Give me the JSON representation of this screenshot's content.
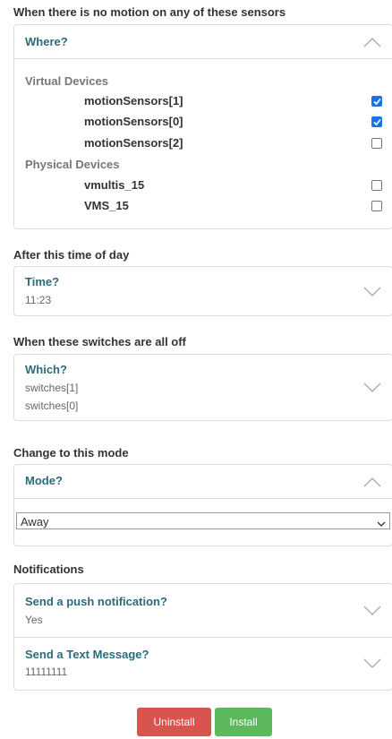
{
  "motion": {
    "section_title": "When there is no motion on any of these sensors",
    "header_label": "Where?",
    "group_virtual": "Virtual Devices",
    "group_physical": "Physical Devices",
    "virtual_devices": [
      {
        "name": "motionSensors[1]",
        "checked": true
      },
      {
        "name": "motionSensors[0]",
        "checked": true
      },
      {
        "name": "motionSensors[2]",
        "checked": false
      }
    ],
    "physical_devices": [
      {
        "name": "vmultis_15",
        "checked": false
      },
      {
        "name": "VMS_15",
        "checked": false
      }
    ]
  },
  "time": {
    "section_title": "After this time of day",
    "header_label": "Time?",
    "value": "11:23"
  },
  "switches": {
    "section_title": "When these switches are all off",
    "header_label": "Which?",
    "values": [
      "switches[1]",
      "switches[0]"
    ]
  },
  "mode": {
    "section_title": "Change to this mode",
    "header_label": "Mode?",
    "selected": "Away"
  },
  "notifications": {
    "section_title": "Notifications",
    "push_label": "Send a push notification?",
    "push_value": "Yes",
    "sms_label": "Send a Text Message?",
    "sms_value": "11111111"
  },
  "buttons": {
    "uninstall_label": "Uninstall",
    "install_label": "Install"
  },
  "colors": {
    "accent_text": "#2d6a7b",
    "uninstall_bg": "#d9534f",
    "install_bg": "#5cb85c",
    "checkbox_checked": "#1a73e8"
  },
  "icons": {
    "collapse": "chevron-up-icon",
    "expand": "chevron-down-icon",
    "checked": "checkmark-icon"
  }
}
